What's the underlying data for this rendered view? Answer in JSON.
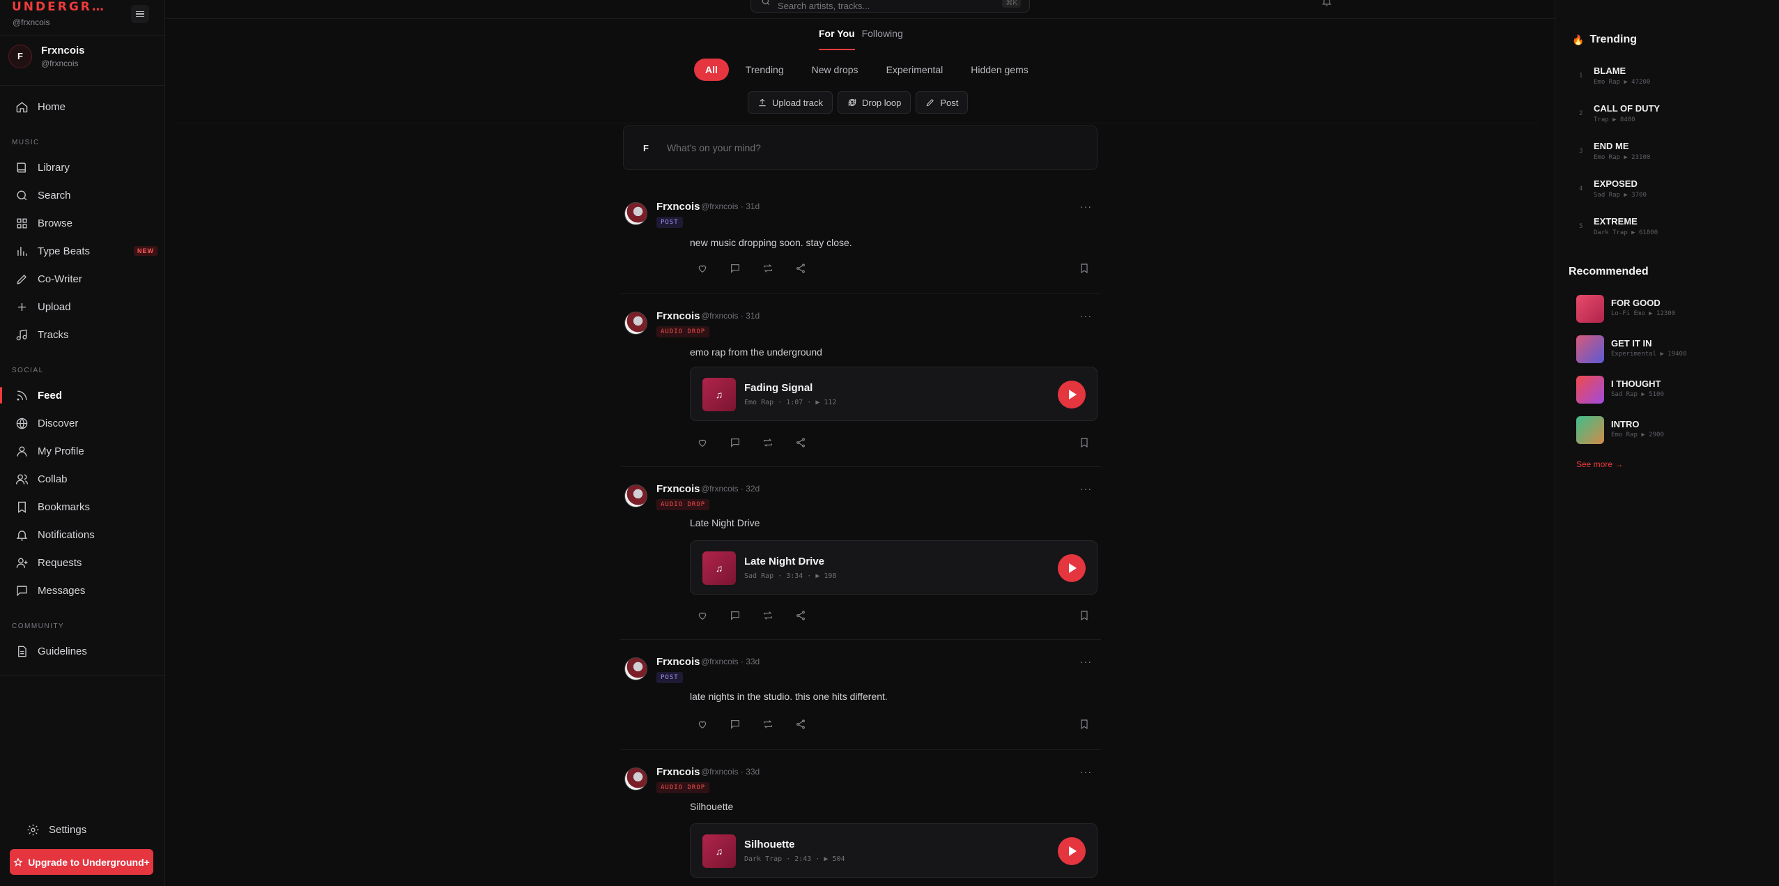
{
  "brand": {
    "name": "UNDERGR…",
    "handle": "@frxncois"
  },
  "user": {
    "initial": "F",
    "name": "Frxncois",
    "handle": "@frxncois"
  },
  "nav": {
    "home": "Home",
    "music_section": "MUSIC",
    "library": "Library",
    "search": "Search",
    "browse": "Browse",
    "type_beats": "Type Beats",
    "new_badge": "NEW",
    "co_writer": "Co-Writer",
    "upload": "Upload",
    "tracks": "Tracks",
    "social_section": "SOCIAL",
    "feed": "Feed",
    "discover": "Discover",
    "my_profile": "My Profile",
    "collab": "Collab",
    "bookmarks": "Bookmarks",
    "notifications": "Notifications",
    "requests": "Requests",
    "messages": "Messages",
    "community_section": "COMMUNITY",
    "guidelines": "Guidelines",
    "settings": "Settings",
    "upgrade": "Upgrade to Underground+"
  },
  "search": {
    "placeholder": "Search artists, tracks...",
    "shortcut": "⌘K"
  },
  "feed": {
    "tabs": [
      "For You",
      "Following"
    ],
    "chips": [
      "All",
      "Trending",
      "New drops",
      "Experimental",
      "Hidden gems"
    ],
    "actions": [
      "Upload track",
      "Drop loop",
      "Post"
    ],
    "composer": {
      "initial": "F",
      "placeholder": "What's on your mind?"
    }
  },
  "posts": [
    {
      "name": "Frxncois",
      "meta": "@frxncois · 31d",
      "tag": "POST",
      "text": "new music dropping soon. stay close."
    },
    {
      "name": "Frxncois",
      "meta": "@frxncois · 31d",
      "tag": "AUDIO DROP",
      "text": "emo rap from the underground",
      "track": {
        "title": "Fading Signal",
        "meta": "Emo Rap · 1:07 · ▶ 112"
      }
    },
    {
      "name": "Frxncois",
      "meta": "@frxncois · 32d",
      "tag": "AUDIO DROP",
      "text": "Late Night Drive",
      "track": {
        "title": "Late Night Drive",
        "meta": "Sad Rap · 3:34 · ▶ 198"
      }
    },
    {
      "name": "Frxncois",
      "meta": "@frxncois · 33d",
      "tag": "POST",
      "text": "late nights in the studio. this one hits different."
    },
    {
      "name": "Frxncois",
      "meta": "@frxncois · 33d",
      "tag": "AUDIO DROP",
      "text": "Silhouette",
      "track": {
        "title": "Silhouette",
        "meta": "Dark Trap · 2:43 · ▶ 504"
      }
    }
  ],
  "trending": {
    "title": "Trending",
    "items": [
      {
        "rank": "1",
        "title": "BLAME",
        "sub": "Emo Rap ▶ 47200"
      },
      {
        "rank": "2",
        "title": "CALL OF DUTY",
        "sub": "Trap ▶ 8400"
      },
      {
        "rank": "3",
        "title": "END ME",
        "sub": "Emo Rap ▶ 23100"
      },
      {
        "rank": "4",
        "title": "EXPOSED",
        "sub": "Sad Rap ▶ 3700"
      },
      {
        "rank": "5",
        "title": "EXTREME",
        "sub": "Dark Trap ▶ 61800"
      }
    ]
  },
  "recommended": {
    "title": "Recommended",
    "items": [
      {
        "title": "FOR GOOD",
        "sub": "Lo-Fi Emo ▶ 12300"
      },
      {
        "title": "GET IT IN",
        "sub": "Experimental ▶ 19400"
      },
      {
        "title": "I THOUGHT",
        "sub": "Sad Rap ▶ 5100"
      },
      {
        "title": "INTRO",
        "sub": "Emo Rap ▶ 2900"
      }
    ],
    "see_more": "See more →"
  },
  "colors": {
    "accent": "#e5353f",
    "background": "#0d0d0e",
    "panel": "#0f0f10"
  }
}
